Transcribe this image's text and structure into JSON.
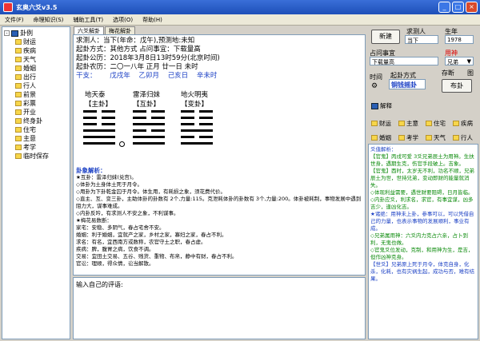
{
  "window": {
    "title": "玄奥六爻v3.5"
  },
  "menu": [
    "文件(F)",
    "命理知识(S)",
    "辅助工具(T)",
    "选项(O)",
    "帮助(H)"
  ],
  "tree": {
    "root": "卦例",
    "items": [
      "财运",
      "疾病",
      "天气",
      "婚姻",
      "出行",
      "行人",
      "前景",
      "彩票",
      "开业",
      "终身卦",
      "住宅",
      "主意",
      "考学",
      "临时保存"
    ]
  },
  "tabs": [
    "六爻解卦",
    "梅花解卦"
  ],
  "info": {
    "line1": "求测人：当下(年命：戊午),预测地:未知",
    "line2": "起卦方式：其他方式    占问事宜：下载量高",
    "line3": "起卦公历：2018年3月8日13时59分(北京时间)",
    "line4": "起卦农历：二〇一八年 正月 廿一日 未时",
    "ganzhi_label": "干支：",
    "ganzhi": [
      "戊戌年",
      "乙卯月",
      "己亥日",
      "辛未时"
    ]
  },
  "gua": [
    {
      "name": "地天泰",
      "role": "【主卦】"
    },
    {
      "name": "雷泽归妹",
      "role": "【互卦】"
    },
    {
      "name": "地火明夷",
      "role": "【变卦】"
    }
  ],
  "analysis": {
    "title": "卦象解析：",
    "lines": [
      "★互卦：雷泽归妹(兑宫)。",
      "◇体卦为土身体土死于月令。",
      "◇用卦为下卦乾金囚于月令。体生用，有耗损之象，须花费代价。",
      "◇直主、互、变三卦，主助体卦的卦数有 2个,力量:115。克泄耗体卦的卦数有 3个,力量:200。体卦被耗制，事物发展中遇到阻力大，谋事难成。",
      "◇内卦反吟，有求测人不安之象，不利谋事。",
      "★梅花易数断：",
      "家宅：安稳、多阴气，春占宅舍不安。",
      "婚姻：利于婚姻，宜就产之家，乡村之家，寡妇之家，春占不利。",
      "求名：有名，宜西南方或数称，农官守土之职，春占虚。",
      "疾病：脾，腹胃之病，饮食不调。",
      "交易：宜田土交易、五谷、贱货、重物、布帛，静中有财，春占不利。",
      "官讼：理顺，得众情，讼当解散。"
    ]
  },
  "comment": {
    "label": "输入自己的评语:"
  },
  "right": {
    "new_button": "新建",
    "querent_label": "求测人",
    "querent_value": "当下",
    "birth_year_label": "生年",
    "birth_year_value": "1978",
    "matter_label": "占问事宜",
    "matter_value": "下载量高",
    "yongshen_label": "用神",
    "yongshen_value": "兄弟",
    "time_label": "时间",
    "method_label": "起卦方式",
    "method_value": "铜钱摇卦",
    "save_label": "存断",
    "image_label": "图",
    "cast_button": "布卦",
    "explain_label": "解释",
    "cats": [
      "财运",
      "主意",
      "住宅",
      "疾病",
      "婚姻",
      "考学",
      "天气",
      "行人"
    ]
  },
  "log": {
    "title": "爻值解析：",
    "lines": [
      "【官鬼】丙戌可爱 3爻兄弟辰土为用神。生扶世身，遇期生克，伤官手段破上。吉象。",
      "【官鬼】酉时，太岁无不利，功名不顺，兄弟辰土为世，世持兄弟，变动即财的能量就消失。",
      "◇体现利益需要，遇世财要阻碍，日月皆临。",
      "◇内卦应爻，利求名，求官，有事宜谋，凶多吉少，逢凶化吉。",
      "★诸绝：用神未上卦，参事可以，可以凭借自己的力量，也表示事物的发展顺利，事业有成。",
      "◇兄弟属用神：六爻内力克占六亲，占卜到利，无鬼也做。",
      "◇官鬼爻位发动，克制，和用神为生，是吉，但作凶神克身。",
      "【世爻】兄弟原上死于月令，体克自身，化杀，化耗，也有灾祸生起，成功与否，难有结果。"
    ]
  }
}
